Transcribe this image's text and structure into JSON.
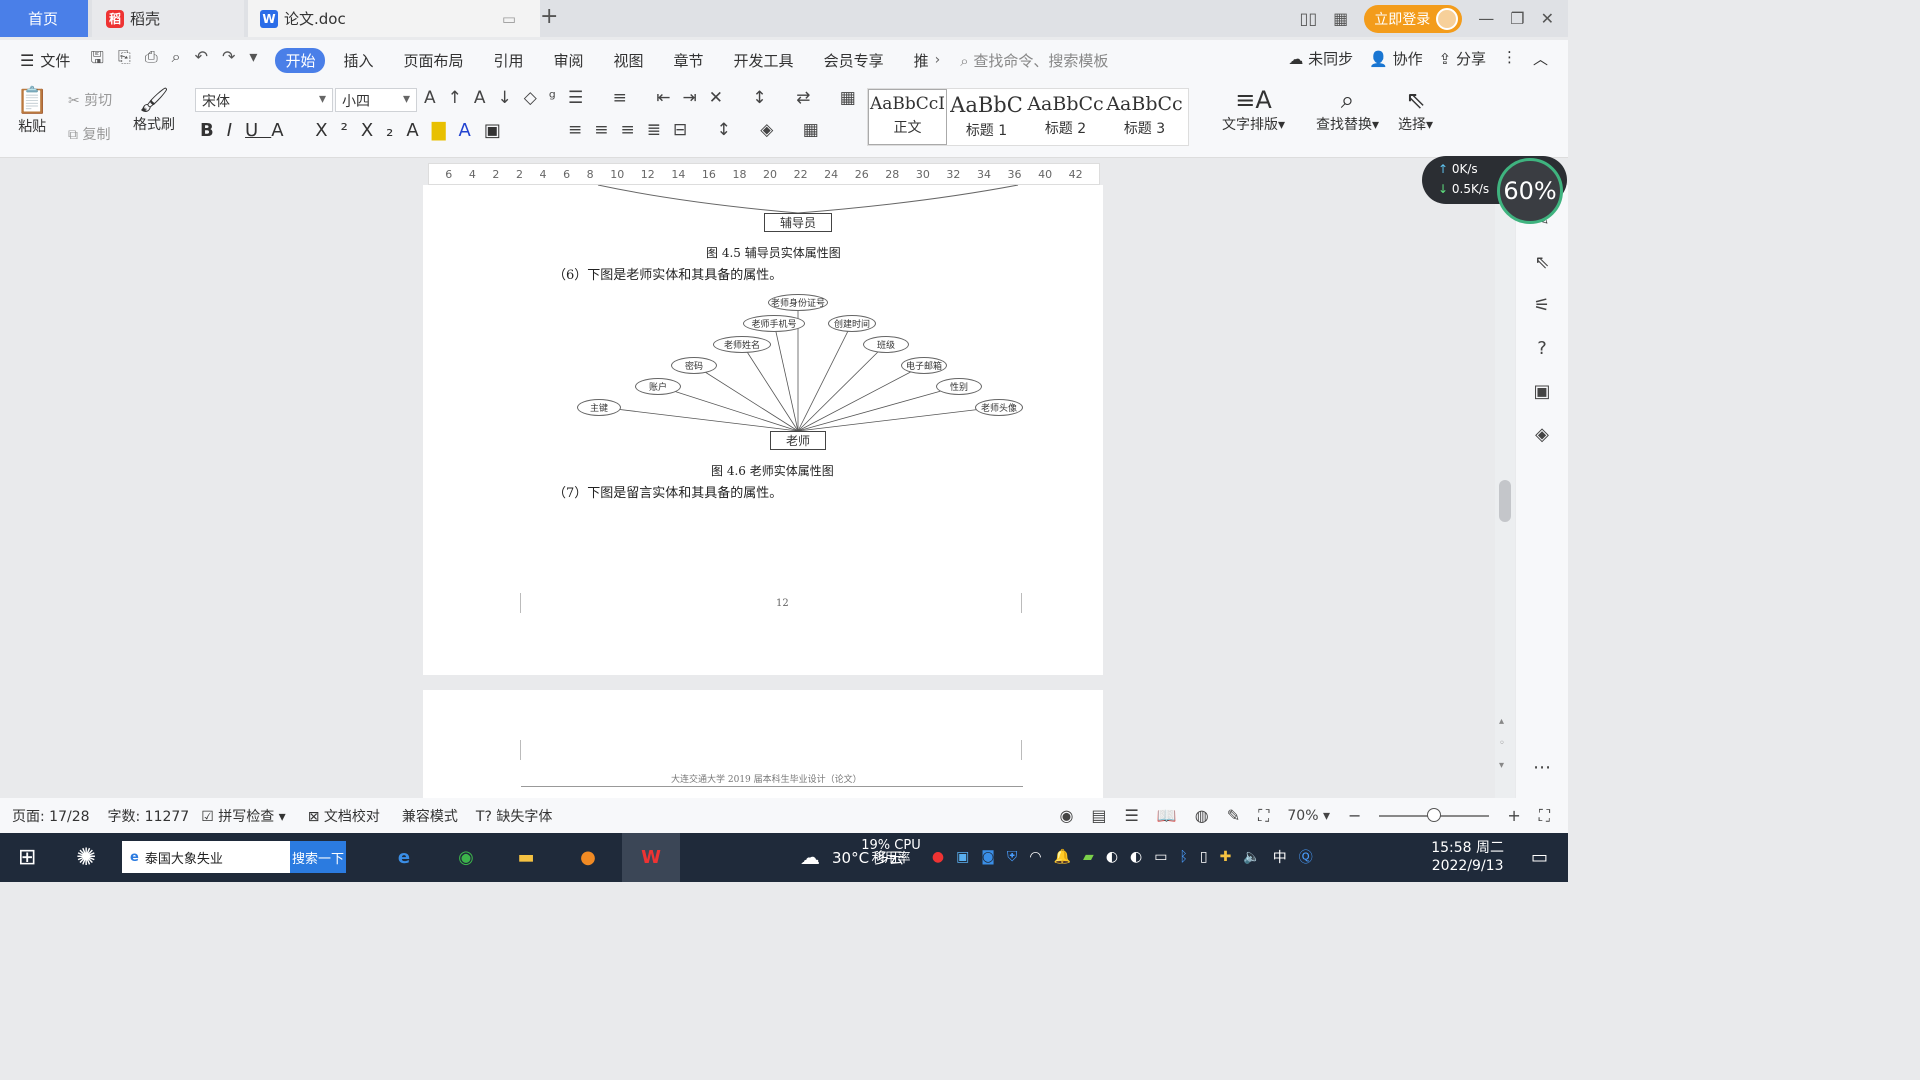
{
  "tabs": {
    "home": "首页",
    "daoke": "稻壳",
    "doc": "论文.doc"
  },
  "topright": {
    "login": "立即登录"
  },
  "menu": {
    "file": "文件",
    "items": [
      "开始",
      "插入",
      "页面布局",
      "引用",
      "审阅",
      "视图",
      "章节",
      "开发工具",
      "会员专享",
      "推"
    ],
    "search": "查找命令、搜索模板",
    "unsync": "未同步",
    "collab": "协作",
    "share": "分享"
  },
  "ribbon": {
    "paste": "粘贴",
    "cut": "剪切",
    "copy": "复制",
    "format_painter": "格式刷",
    "font_name": "宋体",
    "font_size": "小四",
    "styles": [
      {
        "preview": "AaBbCcI",
        "name": "正文"
      },
      {
        "preview": "AaBbC",
        "name": "标题 1"
      },
      {
        "preview": "AaBbCc",
        "name": "标题 2"
      },
      {
        "preview": "AaBbCc",
        "name": "标题 3"
      }
    ],
    "text_layout": "文字排版",
    "find_replace": "查找替换",
    "select": "选择"
  },
  "ruler_marks": [
    "6",
    "4",
    "2",
    "2",
    "4",
    "6",
    "8",
    "10",
    "12",
    "14",
    "16",
    "18",
    "20",
    "22",
    "24",
    "26",
    "28",
    "30",
    "32",
    "34",
    "36",
    "40",
    "42"
  ],
  "speed": {
    "up": "0K/s",
    "down": "0.5K/s",
    "percent": "60%"
  },
  "document": {
    "top_entity": "辅导员",
    "fig45": "图 4.5 辅导员实体属性图",
    "para6": "（6）下图是老师实体和其具备的属性。",
    "teacher_entity": "老师",
    "attributes": [
      "主键",
      "账户",
      "密码",
      "老师姓名",
      "老师手机号",
      "老师身份证号",
      "创建时间",
      "班级",
      "电子邮箱",
      "性别",
      "老师头像"
    ],
    "fig46": "图 4.6 老师实体属性图",
    "para7": "（7）下图是留言实体和其具备的属性。",
    "page_number": "12",
    "next_header": "大连交通大学 2019 届本科生毕业设计（论文）"
  },
  "status": {
    "page": "页面: 17/28",
    "words": "字数: 11277",
    "spell": "拼写检查",
    "proof": "文档校对",
    "compat": "兼容模式",
    "missing_font": "缺失字体",
    "zoom": "70%"
  },
  "taskbar": {
    "search_text": "泰国大象失业",
    "search_btn": "搜索一下",
    "weather": "30°C 多云",
    "cpu": "19% CPU利用率",
    "ime": "中",
    "time": "15:58 周二",
    "date": "2022/9/13"
  }
}
